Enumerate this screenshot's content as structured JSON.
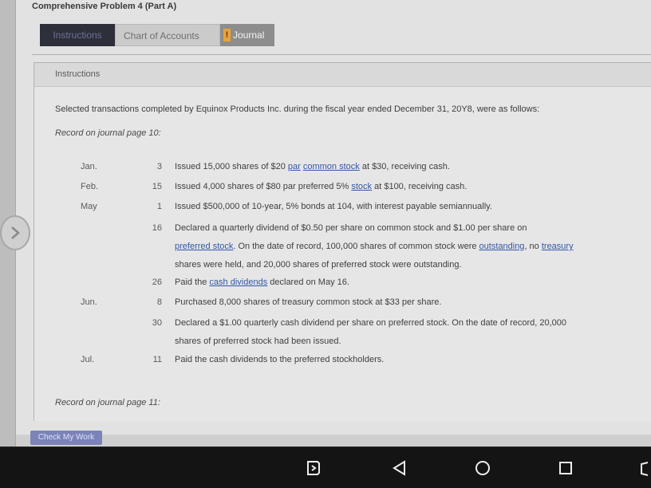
{
  "header": {
    "title": "Comprehensive Problem 4 (Part A)"
  },
  "tabs": {
    "instructions": "Instructions",
    "chart_of_accounts": "Chart of Accounts",
    "journal_warning": "!",
    "journal": "Journal"
  },
  "panel": {
    "header": "Instructions",
    "intro": "Selected transactions completed by Equinox Products Inc. during the fiscal year ended December 31, 20Y8, were as follows:",
    "record_page_10": "Record on journal page 10:",
    "record_page_11": "Record on journal page 11:"
  },
  "transactions": [
    {
      "month": "Jan.",
      "day": "3",
      "lines": [
        [
          {
            "t": "Issued 15,000 shares of $20 "
          },
          {
            "t": "par",
            "link": true
          },
          {
            "t": " "
          },
          {
            "t": "common stock",
            "link": true
          },
          {
            "t": " at $30, receiving cash."
          }
        ]
      ]
    },
    {
      "month": "Feb.",
      "day": "15",
      "lines": [
        [
          {
            "t": "Issued 4,000 shares of $80 par preferred 5% "
          },
          {
            "t": "stock",
            "link": true
          },
          {
            "t": " at $100, receiving cash."
          }
        ]
      ]
    },
    {
      "month": "May",
      "day": "1",
      "lines": [
        [
          {
            "t": "Issued $500,000 of 10-year, 5% bonds at 104, with interest payable semiannually."
          }
        ]
      ]
    },
    {
      "month": "",
      "day": "16",
      "lines": [
        [
          {
            "t": "Declared a quarterly dividend of $0.50 per share on common stock and $1.00 per share on"
          }
        ],
        [
          {
            "t": "preferred stock",
            "link": true
          },
          {
            "t": ". On the date of record, 100,000 shares of common stock were "
          },
          {
            "t": "outstanding",
            "link": true
          },
          {
            "t": ", no "
          },
          {
            "t": "treasury",
            "link": true
          }
        ],
        [
          {
            "t": "shares were held, and 20,000 shares of preferred stock were outstanding."
          }
        ]
      ]
    },
    {
      "month": "",
      "day": "26",
      "lines": [
        [
          {
            "t": "Paid the "
          },
          {
            "t": "cash dividends",
            "link": true
          },
          {
            "t": " declared on May 16."
          }
        ]
      ]
    },
    {
      "month": "Jun.",
      "day": "8",
      "lines": [
        [
          {
            "t": "Purchased 8,000 shares of treasury common stock at $33 per share."
          }
        ]
      ]
    },
    {
      "month": "",
      "day": "30",
      "lines": [
        [
          {
            "t": "Declared a $1.00 quarterly cash dividend per share on preferred stock. On the date of record, 20,000"
          }
        ],
        [
          {
            "t": "shares of preferred stock had been issued."
          }
        ]
      ]
    },
    {
      "month": "Jul.",
      "day": "11",
      "lines": [
        [
          {
            "t": "Paid the cash dividends to the preferred stockholders."
          }
        ]
      ]
    }
  ],
  "footer": {
    "check_my_work": "Check My Work"
  },
  "colors": {
    "link": "#3557a8",
    "active_tab": "#2d2f3a",
    "warning": "#e8a33a",
    "check_button": "#7b83b8"
  }
}
